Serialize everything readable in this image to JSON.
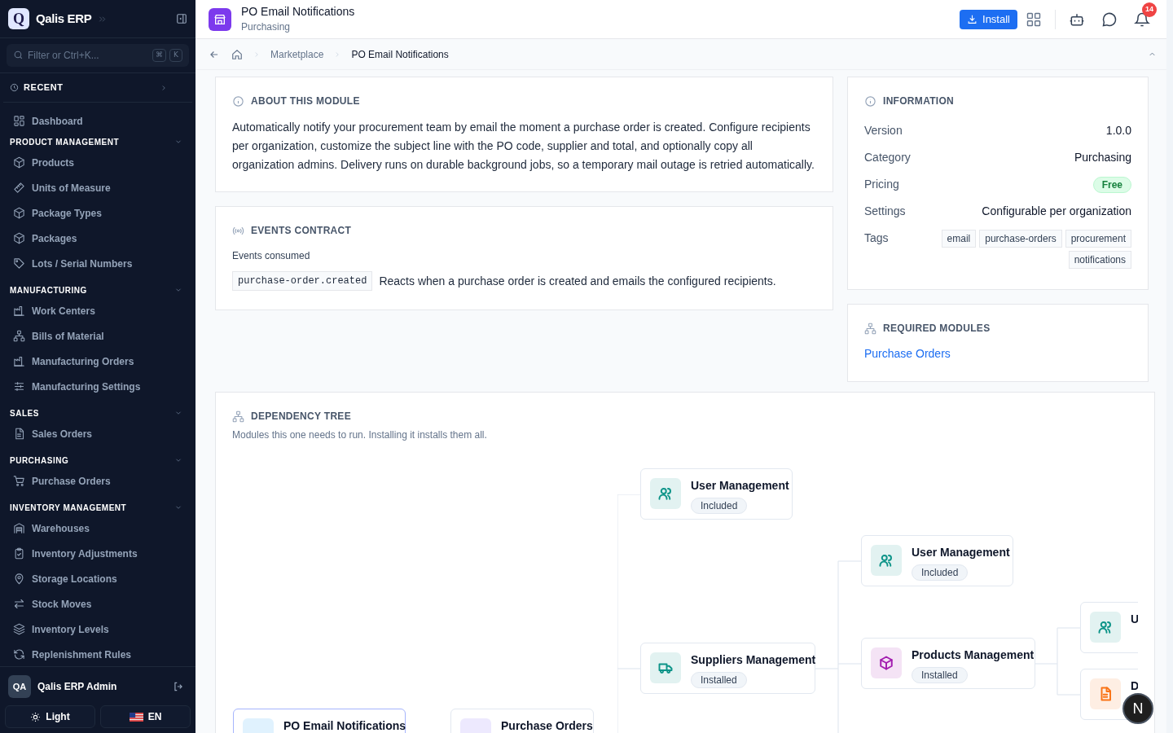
{
  "sidebar": {
    "brand": {
      "logo": "Q",
      "name": "Qalis ERP"
    },
    "search": {
      "placeholder": "Filter or Ctrl+K...",
      "keys": [
        "⌘",
        "K"
      ]
    },
    "recent": {
      "label": "RECENT",
      "expanded": false
    },
    "top_items": [
      {
        "label": "Dashboard",
        "kind": "grid"
      }
    ],
    "sections": [
      {
        "title": "PRODUCT MANAGEMENT",
        "expanded": true,
        "items": [
          {
            "label": "Products",
            "kind": "box"
          },
          {
            "label": "Units of Measure",
            "kind": "ruler"
          },
          {
            "label": "Package Types",
            "kind": "box"
          },
          {
            "label": "Packages",
            "kind": "box"
          },
          {
            "label": "Lots / Serial Numbers",
            "kind": "tag"
          }
        ]
      },
      {
        "title": "MANUFACTURING",
        "expanded": true,
        "items": [
          {
            "label": "Work Centers",
            "kind": "factory"
          },
          {
            "label": "Bills of Material",
            "kind": "network"
          },
          {
            "label": "Manufacturing Orders",
            "kind": "factory"
          },
          {
            "label": "Manufacturing Settings",
            "kind": "sliders"
          }
        ]
      },
      {
        "title": "SALES",
        "expanded": true,
        "items": [
          {
            "label": "Sales Orders",
            "kind": "doc"
          }
        ]
      },
      {
        "title": "PURCHASING",
        "expanded": true,
        "items": [
          {
            "label": "Purchase Orders",
            "kind": "cart"
          }
        ]
      },
      {
        "title": "INVENTORY MANAGEMENT",
        "expanded": true,
        "items": [
          {
            "label": "Warehouses",
            "kind": "warehouse"
          },
          {
            "label": "Inventory Adjustments",
            "kind": "clipboard"
          },
          {
            "label": "Storage Locations",
            "kind": "pin"
          },
          {
            "label": "Stock Moves",
            "kind": "arrows"
          },
          {
            "label": "Inventory Levels",
            "kind": "layers"
          },
          {
            "label": "Replenishment Rules",
            "kind": "refresh"
          }
        ]
      }
    ],
    "user": {
      "initials": "QA",
      "name": "Qalis ERP Admin"
    },
    "theme_button": "Light",
    "language_button": "EN"
  },
  "header": {
    "title": "PO Email Notifications",
    "subtitle": "Purchasing",
    "install_button": "Install",
    "notification_count": "14"
  },
  "breadcrumb": [
    "Marketplace",
    "PO Email Notifications"
  ],
  "about": {
    "title": "ABOUT THIS MODULE",
    "text": "Automatically notify your procurement team by email the moment a purchase order is created. Configure recipients per organization, customize the subject line with the PO code, supplier and total, and optionally copy all organization admins. Delivery runs on durable background jobs, so a temporary mail outage is retried automatically."
  },
  "events": {
    "title": "EVENTS CONTRACT",
    "subtitle": "Events consumed",
    "items": [
      {
        "code": "purchase-order.created",
        "description": "Reacts when a purchase order is created and emails the configured recipients."
      }
    ]
  },
  "information": {
    "title": "INFORMATION",
    "rows": [
      {
        "label": "Version",
        "value": "1.0.0",
        "kind": "text"
      },
      {
        "label": "Category",
        "value": "Purchasing",
        "kind": "text"
      },
      {
        "label": "Pricing",
        "value": "Free",
        "kind": "badge"
      },
      {
        "label": "Settings",
        "value": "Configurable per organization",
        "kind": "text"
      }
    ],
    "tags_label": "Tags",
    "tags": [
      "email",
      "purchase-orders",
      "procurement",
      "notifications"
    ]
  },
  "required_modules": {
    "title": "REQUIRED MODULES",
    "links": [
      "Purchase Orders"
    ]
  },
  "dependency_tree": {
    "title": "DEPENDENCY TREE",
    "subtitle": "Modules this one needs to run. Installing it installs them all.",
    "nodes": [
      {
        "name": "User Management",
        "status": "Included",
        "kind": "users",
        "color": "#0d9488",
        "selected": false
      },
      {
        "name": "User Management",
        "status": "Included",
        "kind": "users",
        "color": "#0d9488",
        "selected": false
      },
      {
        "name": "Suppliers Management",
        "status": "Installed",
        "kind": "truck",
        "color": "#0d9488",
        "selected": false
      },
      {
        "name": "Products Management",
        "status": "Installed",
        "kind": "box",
        "color": "#a21caf",
        "selected": false
      },
      {
        "name": "U",
        "kind": "users",
        "color": "#0d9488",
        "selected": false
      },
      {
        "name": "D",
        "kind": "doc",
        "color": "#f97316",
        "selected": false
      },
      {
        "name": "PO Email Notifications",
        "kind": "none",
        "selected": true
      },
      {
        "name": "Purchase Orders",
        "kind": "none",
        "selected": false
      }
    ]
  },
  "dev_badge": "N"
}
